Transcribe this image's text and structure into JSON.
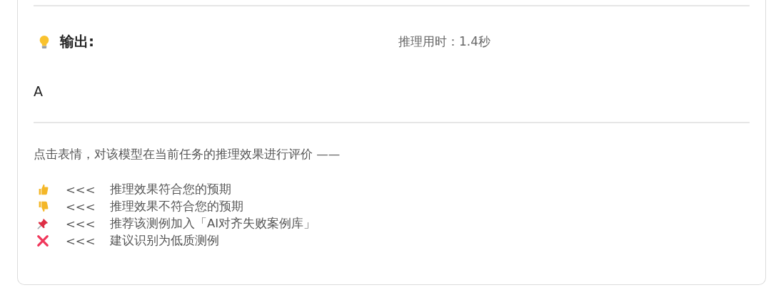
{
  "output": {
    "title": "输出:",
    "timing": "推理用时：1.4秒",
    "result": "A"
  },
  "rating": {
    "prompt": "点击表情，对该模型在当前任务的推理效果进行评价 ——",
    "options": [
      {
        "kind": "thumbs_up",
        "arrow": "<<<",
        "label": "推理效果符合您的预期"
      },
      {
        "kind": "thumbs_down",
        "arrow": "<<<",
        "label": "推理效果不符合您的预期"
      },
      {
        "kind": "pin",
        "arrow": "<<<",
        "label": "推荐该测例加入「AI对齐失败案例库」"
      },
      {
        "kind": "cross",
        "arrow": "<<<",
        "label": "建议识别为低质测例"
      }
    ]
  }
}
